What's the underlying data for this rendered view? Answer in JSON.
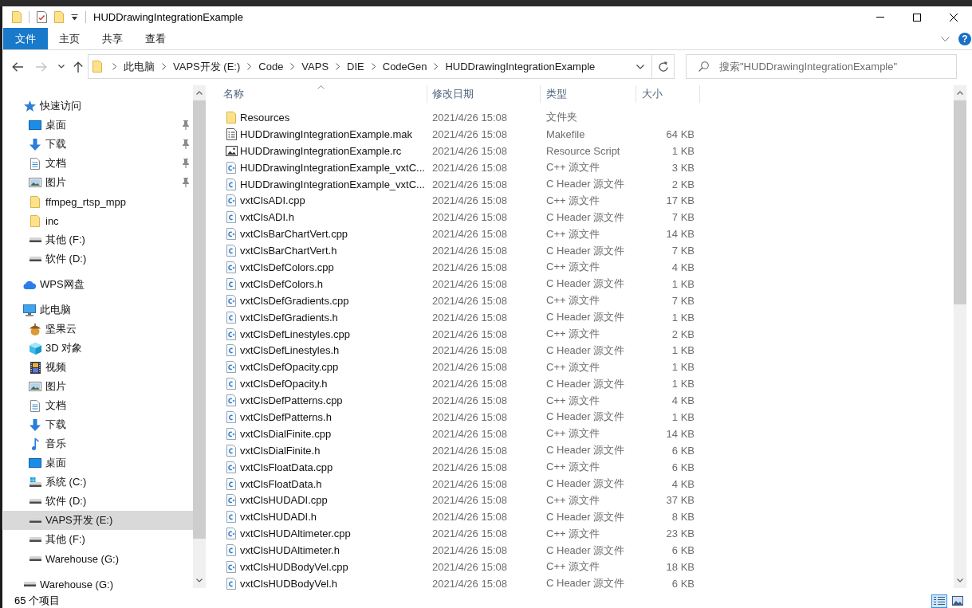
{
  "window": {
    "title": "HUDDrawingIntegrationExample"
  },
  "ribbon": {
    "tabs": [
      {
        "label": "文件",
        "kind": "file",
        "selected": false
      },
      {
        "label": "主页",
        "kind": "tab",
        "selected": false
      },
      {
        "label": "共享",
        "kind": "tab",
        "selected": false
      },
      {
        "label": "查看",
        "kind": "tab",
        "selected": false
      }
    ],
    "help_button": "?"
  },
  "navigation": [
    {
      "kind": "back",
      "disabled": false
    },
    {
      "kind": "forward",
      "disabled": true
    },
    {
      "kind": "recent",
      "disabled": false
    },
    {
      "kind": "up",
      "disabled": false
    }
  ],
  "address_bar": {
    "crumbs": [
      "此电脑",
      "VAPS开发 (E:)",
      "Code",
      "VAPS",
      "DIE",
      "CodeGen",
      "HUDDrawingIntegrationExample"
    ]
  },
  "search": {
    "placeholder": "搜索\"HUDDrawingIntegrationExample\""
  },
  "sidebar": {
    "items": [
      {
        "label": "快速访问",
        "kind": "star",
        "selected": false,
        "children": [
          {
            "label": "桌面",
            "kind": "desktop",
            "pinned": true,
            "selected": false
          },
          {
            "label": "下载",
            "kind": "download",
            "pinned": true,
            "selected": false
          },
          {
            "label": "文档",
            "kind": "document",
            "pinned": true,
            "selected": false
          },
          {
            "label": "图片",
            "kind": "picture",
            "pinned": true,
            "selected": false
          },
          {
            "label": "ffmpeg_rtsp_mpp",
            "kind": "folder",
            "pinned": false,
            "selected": false
          },
          {
            "label": "inc",
            "kind": "folder",
            "pinned": false,
            "selected": false
          },
          {
            "label": "其他 (F:)",
            "kind": "drive",
            "pinned": false,
            "selected": false
          },
          {
            "label": "软件 (D:)",
            "kind": "drive",
            "pinned": false,
            "selected": false
          }
        ]
      },
      {
        "label": "WPS网盘",
        "kind": "cloud",
        "selected": false
      },
      {
        "label": "此电脑",
        "kind": "computer",
        "selected": false,
        "children": [
          {
            "label": "坚果云",
            "kind": "acorn",
            "selected": false
          },
          {
            "label": "3D 对象",
            "kind": "cube",
            "selected": false
          },
          {
            "label": "视频",
            "kind": "video",
            "selected": false
          },
          {
            "label": "图片",
            "kind": "picture",
            "selected": false
          },
          {
            "label": "文档",
            "kind": "document",
            "selected": false
          },
          {
            "label": "下载",
            "kind": "download",
            "selected": false
          },
          {
            "label": "音乐",
            "kind": "music",
            "selected": false
          },
          {
            "label": "桌面",
            "kind": "desktop",
            "selected": false
          },
          {
            "label": "系统 (C:)",
            "kind": "sysdrive",
            "selected": false
          },
          {
            "label": "软件 (D:)",
            "kind": "drive",
            "selected": false
          },
          {
            "label": "VAPS开发 (E:)",
            "kind": "drive",
            "selected": true
          },
          {
            "label": "其他 (F:)",
            "kind": "drive",
            "selected": false
          },
          {
            "label": "Warehouse (G:)",
            "kind": "drive",
            "selected": false
          }
        ]
      },
      {
        "label": "Warehouse (G:)",
        "kind": "drive",
        "selected": false
      }
    ]
  },
  "table": {
    "columns": [
      {
        "label": "名称",
        "sorted": true
      },
      {
        "label": "修改日期",
        "sorted": false
      },
      {
        "label": "类型",
        "sorted": false
      },
      {
        "label": "大小",
        "sorted": false
      }
    ],
    "rows": [
      {
        "name": "Resources",
        "modified": "2021/4/26 15:08",
        "type": "文件夹",
        "kind": "folder",
        "selected": false
      },
      {
        "name": "HUDDrawingIntegrationExample.mak",
        "modified": "2021/4/26 15:08",
        "type": "Makefile",
        "size": "64 KB",
        "kind": "mak",
        "selected": false
      },
      {
        "name": "HUDDrawingIntegrationExample.rc",
        "modified": "2021/4/26 15:08",
        "type": "Resource Script",
        "size": "1 KB",
        "kind": "rc",
        "selected": false
      },
      {
        "name": "HUDDrawingIntegrationExample_vxtC...",
        "modified": "2021/4/26 15:08",
        "type": "C++ 源文件",
        "size": "3 KB",
        "kind": "cpp",
        "selected": false
      },
      {
        "name": "HUDDrawingIntegrationExample_vxtC...",
        "modified": "2021/4/26 15:08",
        "type": "C Header 源文件",
        "size": "2 KB",
        "kind": "h",
        "selected": false
      },
      {
        "name": "vxtClsADI.cpp",
        "modified": "2021/4/26 15:08",
        "type": "C++ 源文件",
        "size": "17 KB",
        "kind": "cpp",
        "selected": false
      },
      {
        "name": "vxtClsADI.h",
        "modified": "2021/4/26 15:08",
        "type": "C Header 源文件",
        "size": "7 KB",
        "kind": "h",
        "selected": false
      },
      {
        "name": "vxtClsBarChartVert.cpp",
        "modified": "2021/4/26 15:08",
        "type": "C++ 源文件",
        "size": "14 KB",
        "kind": "cpp",
        "selected": false
      },
      {
        "name": "vxtClsBarChartVert.h",
        "modified": "2021/4/26 15:08",
        "type": "C Header 源文件",
        "size": "7 KB",
        "kind": "h",
        "selected": false
      },
      {
        "name": "vxtClsDefColors.cpp",
        "modified": "2021/4/26 15:08",
        "type": "C++ 源文件",
        "size": "4 KB",
        "kind": "cpp",
        "selected": false
      },
      {
        "name": "vxtClsDefColors.h",
        "modified": "2021/4/26 15:08",
        "type": "C Header 源文件",
        "size": "1 KB",
        "kind": "h",
        "selected": false
      },
      {
        "name": "vxtClsDefGradients.cpp",
        "modified": "2021/4/26 15:08",
        "type": "C++ 源文件",
        "size": "7 KB",
        "kind": "cpp",
        "selected": false
      },
      {
        "name": "vxtClsDefGradients.h",
        "modified": "2021/4/26 15:08",
        "type": "C Header 源文件",
        "size": "1 KB",
        "kind": "h",
        "selected": false
      },
      {
        "name": "vxtClsDefLinestyles.cpp",
        "modified": "2021/4/26 15:08",
        "type": "C++ 源文件",
        "size": "2 KB",
        "kind": "cpp",
        "selected": false
      },
      {
        "name": "vxtClsDefLinestyles.h",
        "modified": "2021/4/26 15:08",
        "type": "C Header 源文件",
        "size": "1 KB",
        "kind": "h",
        "selected": false
      },
      {
        "name": "vxtClsDefOpacity.cpp",
        "modified": "2021/4/26 15:08",
        "type": "C++ 源文件",
        "size": "1 KB",
        "kind": "cpp",
        "selected": false
      },
      {
        "name": "vxtClsDefOpacity.h",
        "modified": "2021/4/26 15:08",
        "type": "C Header 源文件",
        "size": "1 KB",
        "kind": "h",
        "selected": false
      },
      {
        "name": "vxtClsDefPatterns.cpp",
        "modified": "2021/4/26 15:08",
        "type": "C++ 源文件",
        "size": "4 KB",
        "kind": "cpp",
        "selected": false
      },
      {
        "name": "vxtClsDefPatterns.h",
        "modified": "2021/4/26 15:08",
        "type": "C Header 源文件",
        "size": "1 KB",
        "kind": "h",
        "selected": false
      },
      {
        "name": "vxtClsDialFinite.cpp",
        "modified": "2021/4/26 15:08",
        "type": "C++ 源文件",
        "size": "14 KB",
        "kind": "cpp",
        "selected": false
      },
      {
        "name": "vxtClsDialFinite.h",
        "modified": "2021/4/26 15:08",
        "type": "C Header 源文件",
        "size": "6 KB",
        "kind": "h",
        "selected": false
      },
      {
        "name": "vxtClsFloatData.cpp",
        "modified": "2021/4/26 15:08",
        "type": "C++ 源文件",
        "size": "6 KB",
        "kind": "cpp",
        "selected": false
      },
      {
        "name": "vxtClsFloatData.h",
        "modified": "2021/4/26 15:08",
        "type": "C Header 源文件",
        "size": "4 KB",
        "kind": "h",
        "selected": false
      },
      {
        "name": "vxtClsHUDADI.cpp",
        "modified": "2021/4/26 15:08",
        "type": "C++ 源文件",
        "size": "37 KB",
        "kind": "cpp",
        "selected": false
      },
      {
        "name": "vxtClsHUDADI.h",
        "modified": "2021/4/26 15:08",
        "type": "C Header 源文件",
        "size": "8 KB",
        "kind": "h",
        "selected": false
      },
      {
        "name": "vxtClsHUDAltimeter.cpp",
        "modified": "2021/4/26 15:08",
        "type": "C++ 源文件",
        "size": "23 KB",
        "kind": "cpp",
        "selected": false
      },
      {
        "name": "vxtClsHUDAltimeter.h",
        "modified": "2021/4/26 15:08",
        "type": "C Header 源文件",
        "size": "6 KB",
        "kind": "h",
        "selected": false
      },
      {
        "name": "vxtClsHUDBodyVel.cpp",
        "modified": "2021/4/26 15:08",
        "type": "C++ 源文件",
        "size": "18 KB",
        "kind": "cpp",
        "selected": false
      },
      {
        "name": "vxtClsHUDBodyVel.h",
        "modified": "2021/4/26 15:08",
        "type": "C Header 源文件",
        "size": "6 KB",
        "kind": "h",
        "selected": false
      }
    ]
  },
  "status_bar": {
    "item_count": "65 个项目",
    "views": [
      {
        "kind": "details",
        "selected": true
      },
      {
        "kind": "large-icons",
        "selected": false
      }
    ]
  }
}
